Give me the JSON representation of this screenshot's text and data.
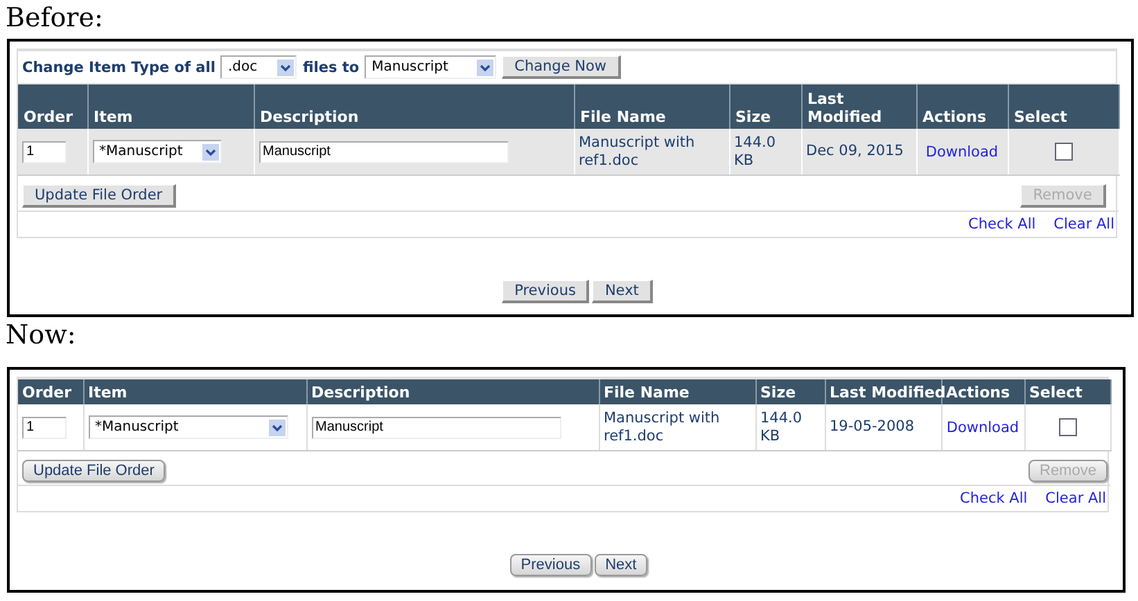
{
  "panels": [
    {
      "heading": "Before:",
      "kind": "classic",
      "change_bar": {
        "label": "Change Item Type of all",
        "ext_select": ".doc",
        "middle": "files to",
        "type_select": "Manuscript",
        "button": "Change Now"
      },
      "columns": [
        "Order",
        "Item",
        "Description",
        "File Name",
        "Size",
        "Last Modified",
        "Actions",
        "Select"
      ],
      "rows": [
        {
          "order": "1",
          "item": "*Manuscript",
          "description": "Manuscript",
          "file_name": "Manuscript with ref1.doc",
          "size": "144.0 KB",
          "modified": "Dec 09, 2015",
          "action": "Download",
          "checked": false
        }
      ],
      "update_button": "Update File Order",
      "remove_button": {
        "label": "Remove",
        "disabled": true
      },
      "links": [
        "Check All",
        "Clear All"
      ],
      "nav": [
        "Previous",
        "Next"
      ]
    },
    {
      "heading": "Now:",
      "kind": "modern",
      "columns": [
        "Order",
        "Item",
        "Description",
        "File Name",
        "Size",
        "Last Modified",
        "Actions",
        "Select"
      ],
      "rows": [
        {
          "order": "1",
          "item": "*Manuscript",
          "description": "Manuscript",
          "file_name": "Manuscript with ref1.doc",
          "size": "144.0 KB",
          "modified": "19-05-2008",
          "action": "Download",
          "checked": false
        }
      ],
      "update_button": "Update File Order",
      "remove_button": {
        "label": "Remove",
        "disabled": true
      },
      "links": [
        "Check All",
        "Clear All"
      ],
      "nav": [
        "Previous",
        "Next"
      ]
    }
  ]
}
